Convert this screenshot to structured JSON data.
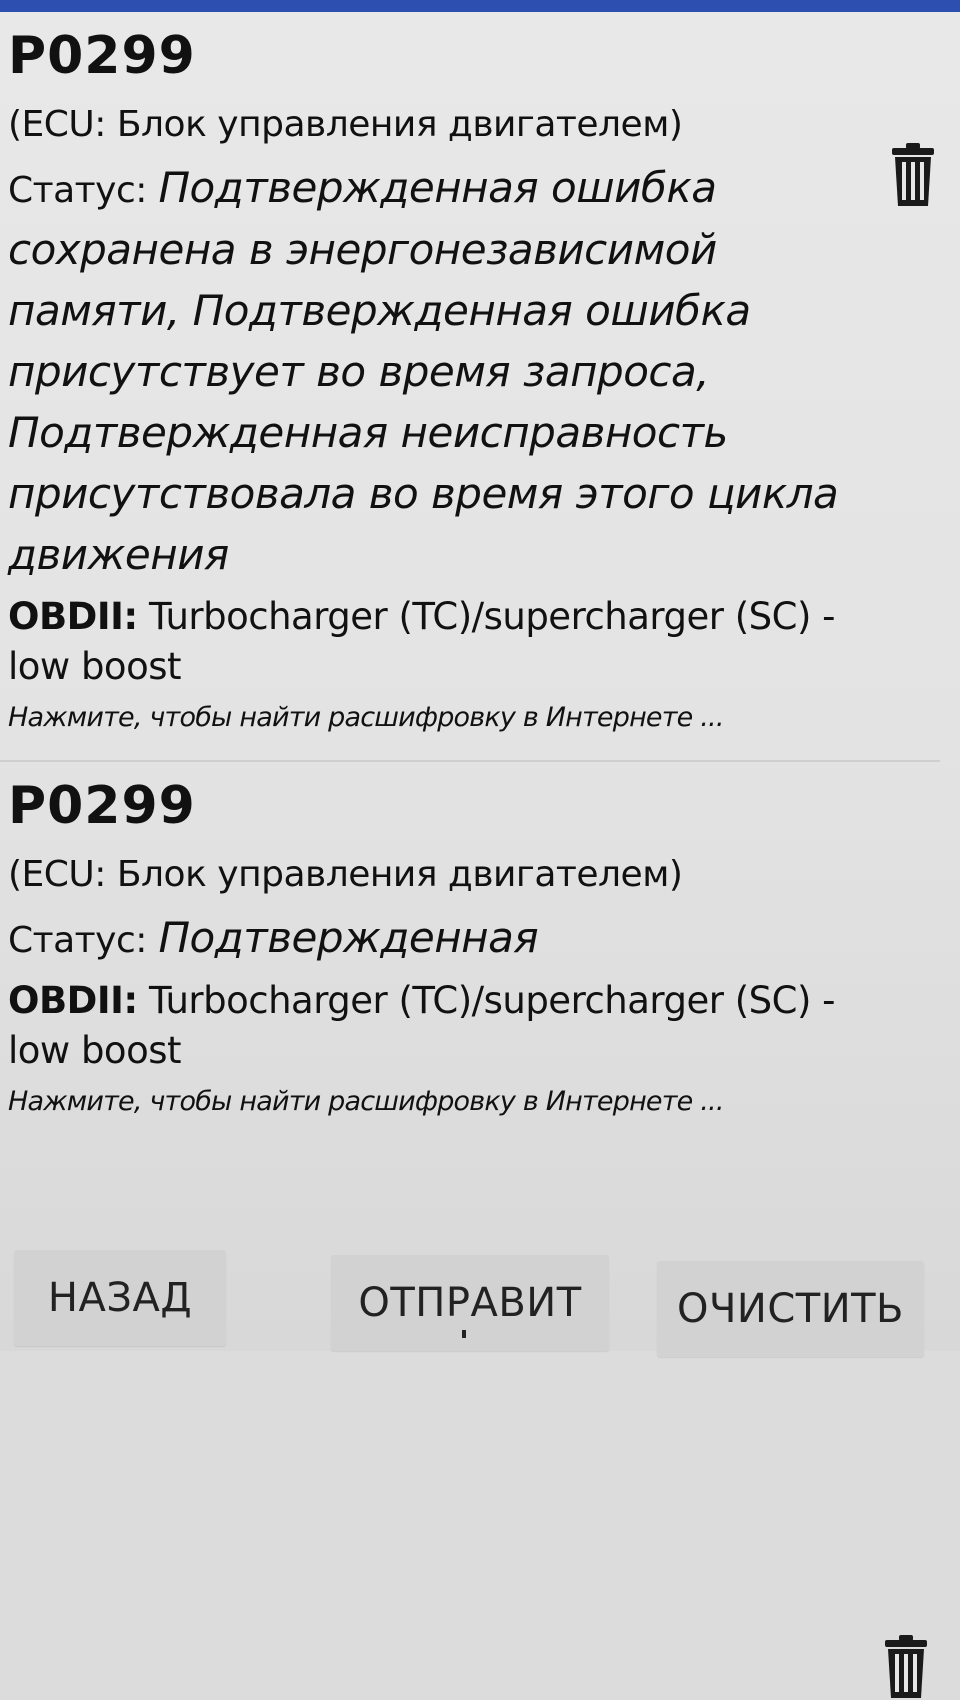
{
  "errors": [
    {
      "code": "P0299",
      "ecu": "(ECU: Блок управления двигателем)",
      "status_label": "Статус:",
      "status_value": "Подтвержденная ошибка сохранена в энергонезависимой памяти, Подтвержденная ошибка присутствует во время запроса, Подтвержденная неисправность присутствовала во время этого цикла движения",
      "obd_label": "OBDII:",
      "obd_value": "Turbocharger (TC)/supercharger (SC) - low boost",
      "hint": "Нажмите, чтобы найти расшифровку в Интернете ...",
      "delete_icon": "trash-icon"
    },
    {
      "code": "P0299",
      "ecu": "(ECU: Блок управления двигателем)",
      "status_label": "Статус:",
      "status_value": "Подтвержденная",
      "obd_label": "OBDII:",
      "obd_value": "Turbocharger (TC)/supercharger (SC) - low boost",
      "hint": "Нажмите, чтобы найти расшифровку в Интернете ...",
      "delete_icon": "trash-icon"
    }
  ],
  "buttons": {
    "back": "НАЗАД",
    "send": "ОТПРАВИТ",
    "clear": "ОЧИСТИТЬ"
  },
  "colors": {
    "top_bar": "#2c4fb0",
    "background": "#e6e6e6",
    "button": "#d2d2d2",
    "text": "#111111"
  }
}
